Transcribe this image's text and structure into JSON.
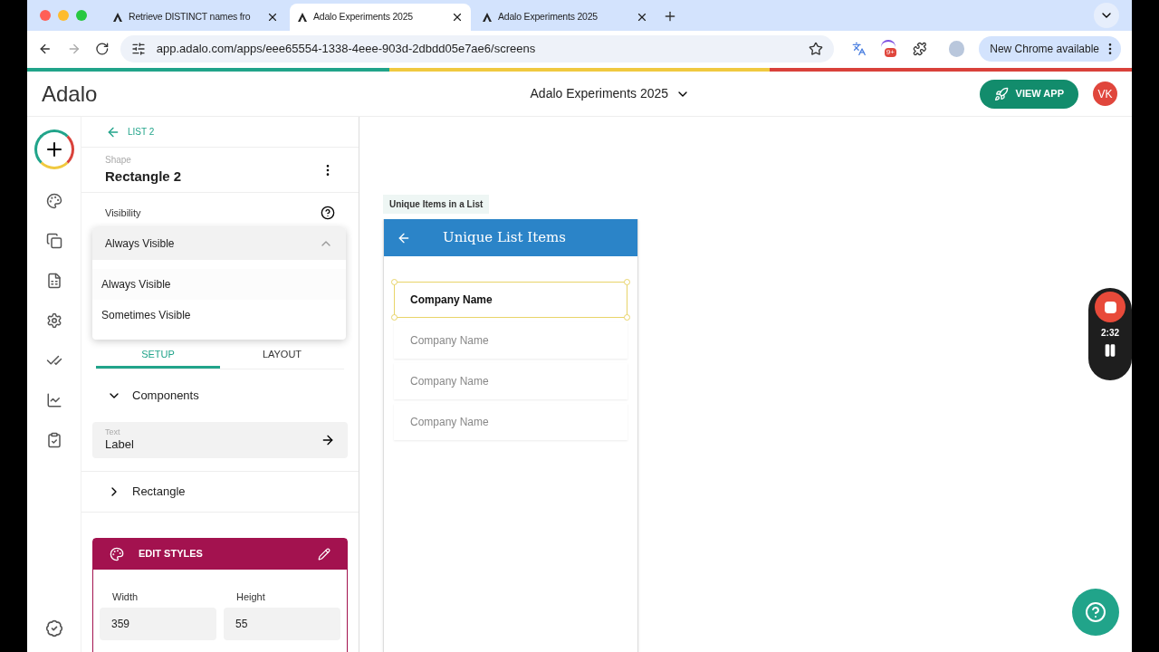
{
  "browser": {
    "tabs": [
      {
        "title": "Retrieve DISTINCT names fro",
        "selected": false
      },
      {
        "title": "Adalo Experiments 2025",
        "selected": true
      },
      {
        "title": "Adalo Experiments 2025",
        "selected": false
      }
    ],
    "url": "app.adalo.com/apps/eee65554-1338-4eee-903d-2dbdd05e7ae6/screens",
    "extension_badge": "9+",
    "update_button": "New Chrome available"
  },
  "header": {
    "logo": "Adalo",
    "project": "Adalo Experiments 2025",
    "view_app": "VIEW APP",
    "avatar": "VK"
  },
  "panel": {
    "back": "LIST 2",
    "type": "Shape",
    "name": "Rectangle 2",
    "visibility_label": "Visibility",
    "visibility": {
      "value": "Always Visible",
      "expanded": true,
      "options": [
        {
          "label": "Always Visible",
          "selected": true
        },
        {
          "label": "Sometimes Visible",
          "selected": false
        }
      ]
    },
    "tabs": [
      {
        "label": "SETUP",
        "selected": true
      },
      {
        "label": "LAYOUT",
        "selected": false
      }
    ],
    "sections": [
      {
        "title": "Components",
        "expanded": true,
        "children": [
          {
            "type": "Text",
            "name": "Label"
          }
        ]
      },
      {
        "title": "Rectangle",
        "expanded": false
      }
    ],
    "edit_styles": {
      "title": "EDIT STYLES",
      "fields": [
        {
          "label": "Width",
          "value": "359"
        },
        {
          "label": "Height",
          "value": "55"
        }
      ]
    }
  },
  "canvas": {
    "screen_label": "Unique Items in a List",
    "screen_title": "Unique List Items",
    "rows": [
      {
        "text": "Company Name",
        "selected": true
      },
      {
        "text": "Company Name",
        "selected": false
      },
      {
        "text": "Company Name",
        "selected": false
      },
      {
        "text": "Company Name",
        "selected": false
      }
    ]
  },
  "recorder": {
    "time": "2:32"
  }
}
